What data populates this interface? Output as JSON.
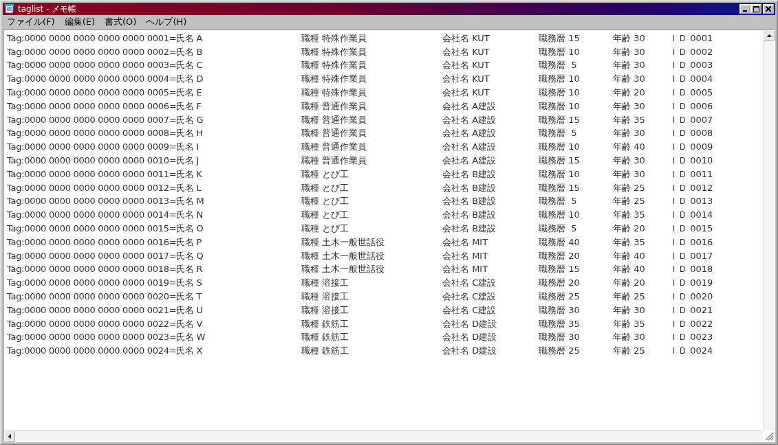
{
  "window": {
    "title": "taglist - メモ帳"
  },
  "menu": [
    "ファイル(F)",
    "編集(E)",
    "書式(O)",
    "ヘルプ(H)"
  ],
  "lines": [
    {
      "tag": "Tag:0000 0000 0000 0000 0000 0001=氏名 A",
      "job": "職種 特殊作業員",
      "company": "会社名 KUT",
      "career": "職務暦 15",
      "age": "年齢 30",
      "id": "ＩＤ 0001"
    },
    {
      "tag": "Tag:0000 0000 0000 0000 0000 0002=氏名 B",
      "job": "職種 特殊作業員",
      "company": "会社名 KUT",
      "career": "職務暦 10",
      "age": "年齢 30",
      "id": "ＩＤ 0002"
    },
    {
      "tag": "Tag:0000 0000 0000 0000 0000 0003=氏名 C",
      "job": "職種 特殊作業員",
      "company": "会社名 KUT",
      "career": "職務暦  5",
      "age": "年齢 30",
      "id": "ＩＤ 0003"
    },
    {
      "tag": "Tag:0000 0000 0000 0000 0000 0004=氏名 D",
      "job": "職種 特殊作業員",
      "company": "会社名 KUT",
      "career": "職務暦 10",
      "age": "年齢 30",
      "id": "ＩＤ 0004"
    },
    {
      "tag": "Tag:0000 0000 0000 0000 0000 0005=氏名 E",
      "job": "職種 特殊作業員",
      "company": "会社名 KUT",
      "career": "職務暦 10",
      "age": "年齢 20",
      "id": "ＩＤ 0005"
    },
    {
      "tag": "Tag:0000 0000 0000 0000 0000 0006=氏名 F",
      "job": "職種 普通作業員",
      "company": "会社名 A建設",
      "career": "職務暦 10",
      "age": "年齢 30",
      "id": "ＩＤ 0006"
    },
    {
      "tag": "Tag:0000 0000 0000 0000 0000 0007=氏名 G",
      "job": "職種 普通作業員",
      "company": "会社名 A建設",
      "career": "職務暦 15",
      "age": "年齢 35",
      "id": "ＩＤ 0007"
    },
    {
      "tag": "Tag:0000 0000 0000 0000 0000 0008=氏名 H",
      "job": "職種 普通作業員",
      "company": "会社名 A建設",
      "career": "職務暦  5",
      "age": "年齢 30",
      "id": "ＩＤ 0008"
    },
    {
      "tag": "Tag:0000 0000 0000 0000 0000 0009=氏名 I",
      "job": "職種 普通作業員",
      "company": "会社名 A建設",
      "career": "職務暦 10",
      "age": "年齢 40",
      "id": "ＩＤ 0009"
    },
    {
      "tag": "Tag:0000 0000 0000 0000 0000 0010=氏名 J",
      "job": "職種 普通作業員",
      "company": "会社名 A建設",
      "career": "職務暦 15",
      "age": "年齢 30",
      "id": "ＩＤ 0010"
    },
    {
      "tag": "Tag:0000 0000 0000 0000 0000 0011=氏名 K",
      "job": "職種 とび工",
      "company": "会社名 B建設",
      "career": "職務暦 10",
      "age": "年齢 30",
      "id": "ＩＤ 0011"
    },
    {
      "tag": "Tag:0000 0000 0000 0000 0000 0012=氏名 L",
      "job": "職種 とび工",
      "company": "会社名 B建設",
      "career": "職務暦 15",
      "age": "年齢 25",
      "id": "ＩＤ 0012"
    },
    {
      "tag": "Tag:0000 0000 0000 0000 0000 0013=氏名 M",
      "job": "職種 とび工",
      "company": "会社名 B建設",
      "career": "職務暦  5",
      "age": "年齢 25",
      "id": "ＩＤ 0013"
    },
    {
      "tag": "Tag:0000 0000 0000 0000 0000 0014=氏名 N",
      "job": "職種 とび工",
      "company": "会社名 B建設",
      "career": "職務暦 10",
      "age": "年齢 35",
      "id": "ＩＤ 0014"
    },
    {
      "tag": "Tag:0000 0000 0000 0000 0000 0015=氏名 O",
      "job": "職種 とび工",
      "company": "会社名 B建設",
      "career": "職務暦  5",
      "age": "年齢 20",
      "id": "ＩＤ 0015"
    },
    {
      "tag": "Tag:0000 0000 0000 0000 0000 0016=氏名 P",
      "job": "職種 土木一般世話役",
      "company": "会社名 MIT",
      "career": "職務暦 40",
      "age": "年齢 35",
      "id": "ＩＤ 0016"
    },
    {
      "tag": "Tag:0000 0000 0000 0000 0000 0017=氏名 Q",
      "job": "職種 土木一般世話役",
      "company": "会社名 MIT",
      "career": "職務暦 20",
      "age": "年齢 40",
      "id": "ＩＤ 0017"
    },
    {
      "tag": "Tag:0000 0000 0000 0000 0000 0018=氏名 R",
      "job": "職種 土木一般世話役",
      "company": "会社名 MIT",
      "career": "職務暦 15",
      "age": "年齢 40",
      "id": "ＩＤ 0018"
    },
    {
      "tag": "Tag:0000 0000 0000 0000 0000 0019=氏名 S",
      "job": "職種 溶接工",
      "company": "会社名 C建設",
      "career": "職務暦 20",
      "age": "年齢 20",
      "id": "ＩＤ 0019"
    },
    {
      "tag": "Tag:0000 0000 0000 0000 0000 0020=氏名 T",
      "job": "職種 溶接工",
      "company": "会社名 C建設",
      "career": "職務暦 25",
      "age": "年齢 25",
      "id": "ＩＤ 0020"
    },
    {
      "tag": "Tag:0000 0000 0000 0000 0000 0021=氏名 U",
      "job": "職種 溶接工",
      "company": "会社名 C建設",
      "career": "職務暦 30",
      "age": "年齢 30",
      "id": "ＩＤ 0021"
    },
    {
      "tag": "Tag:0000 0000 0000 0000 0000 0022=氏名 V",
      "job": "職種 鉄筋工",
      "company": "会社名 D建設",
      "career": "職務暦 35",
      "age": "年齢 35",
      "id": "ＩＤ 0022"
    },
    {
      "tag": "Tag:0000 0000 0000 0000 0000 0023=氏名 W",
      "job": "職種 鉄筋工",
      "company": "会社名 D建設",
      "career": "職務暦 30",
      "age": "年齢 30",
      "id": "ＩＤ 0023"
    },
    {
      "tag": "Tag:0000 0000 0000 0000 0000 0024=氏名 X",
      "job": "職種 鉄筋工",
      "company": "会社名 D建設",
      "career": "職務暦 25",
      "age": "年齢 25",
      "id": "ＩＤ 0024"
    }
  ]
}
